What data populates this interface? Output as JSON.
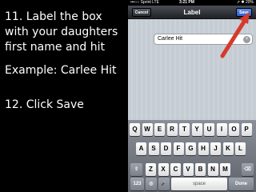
{
  "instructions": {
    "step11": "11. Label the box with your daughters first name and hit",
    "example": "Example: Carlee Hit",
    "step12": "12. Click Save"
  },
  "statusbar": {
    "carrier": "•••○○ Sprint  LTE",
    "time": "3:21 PM",
    "battery": "➚ ✱ 20%"
  },
  "navbar": {
    "title": "Label",
    "cancel_label": "Cancel",
    "save_label": "Save"
  },
  "label_field": {
    "value": "Carlee Hit",
    "clear_icon": "×"
  },
  "arrow_color": "#d63a2a",
  "keyboard": {
    "row1": [
      "Q",
      "W",
      "E",
      "R",
      "T",
      "Y",
      "U",
      "I",
      "O",
      "P"
    ],
    "row2": [
      "A",
      "S",
      "D",
      "F",
      "G",
      "H",
      "J",
      "K",
      "L"
    ],
    "row3": [
      "Z",
      "X",
      "C",
      "V",
      "B",
      "N",
      "M"
    ],
    "shift_icon": "⇧",
    "delete_icon": "⌫",
    "numbers_label": "123",
    "globe_icon": "◎",
    "mic_icon": "🎤",
    "space_label": "space",
    "done_label": "Done"
  }
}
